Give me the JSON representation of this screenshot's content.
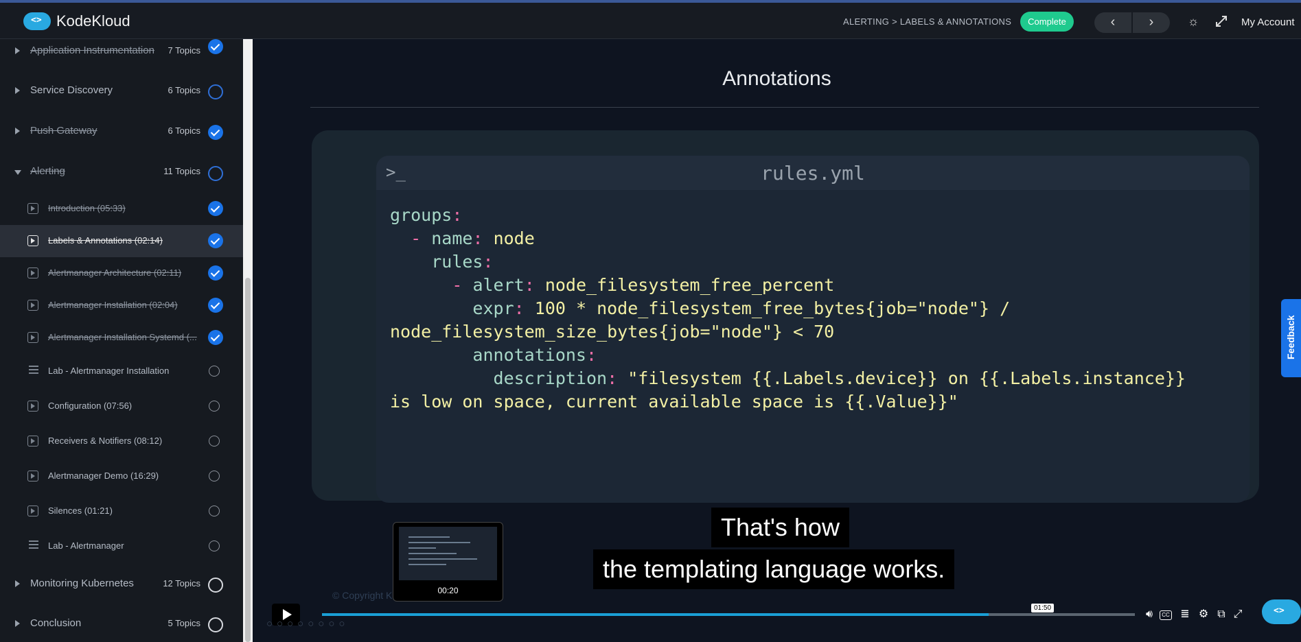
{
  "header": {
    "brand": "KodeKloud",
    "breadcrumb": "ALERTING > LABELS & ANNOTATIONS",
    "complete_label": "Complete",
    "prev_label": "‹",
    "next_label": "›",
    "account_label": "My Account"
  },
  "sidebar": {
    "sections_top": [
      {
        "title": "Application Instrumentation",
        "count": "7 Topics",
        "status": "done",
        "strike": true
      },
      {
        "title": "Service Discovery",
        "count": "6 Topics",
        "status": "ring-blue",
        "strike": false
      },
      {
        "title": "Push Gateway",
        "count": "6 Topics",
        "status": "done",
        "strike": true
      },
      {
        "title": "Alerting",
        "count": "11 Topics",
        "status": "ring-blue",
        "strike": true,
        "open": true
      }
    ],
    "lessons": [
      {
        "title": "Introduction (05:33)",
        "type": "video",
        "done": true
      },
      {
        "title": "Labels & Annotations (02:14)",
        "type": "video",
        "done": true,
        "active": true
      },
      {
        "title": "Alertmanager Architecture (02:11)",
        "type": "video",
        "done": true
      },
      {
        "title": "Alertmanager Installation (02:04)",
        "type": "video",
        "done": true
      },
      {
        "title": "Alertmanager Installation Systemd (...",
        "type": "video",
        "done": true
      },
      {
        "title": "Lab - Alertmanager Installation",
        "type": "lab",
        "done": false
      },
      {
        "title": "Configuration (07:56)",
        "type": "video",
        "done": false
      },
      {
        "title": "Receivers & Notifiers (08:12)",
        "type": "video",
        "done": false
      },
      {
        "title": "Alertmanager Demo (16:29)",
        "type": "video",
        "done": false
      },
      {
        "title": "Silences (01:21)",
        "type": "video",
        "done": false
      },
      {
        "title": "Lab - Alertmanager",
        "type": "lab",
        "done": false
      }
    ],
    "sections_bottom": [
      {
        "title": "Monitoring Kubernetes",
        "count": "12 Topics",
        "status": "ring-light"
      },
      {
        "title": "Conclusion",
        "count": "5 Topics",
        "status": "ring-light"
      }
    ]
  },
  "slide": {
    "title": "Annotations",
    "terminal_prompt": ">_",
    "filename": "rules.yml",
    "copyright": "© Copyright K"
  },
  "video": {
    "thumb_time": "00:20",
    "hover_time": "01:50",
    "progress_fraction": 0.82,
    "caption_line1": "That's how",
    "caption_line2": "the templating language works."
  },
  "feedback_label": "Feedback",
  "colors": {
    "accent": "#1a73e8",
    "complete": "#1fca8e",
    "brand": "#29a9e1"
  }
}
